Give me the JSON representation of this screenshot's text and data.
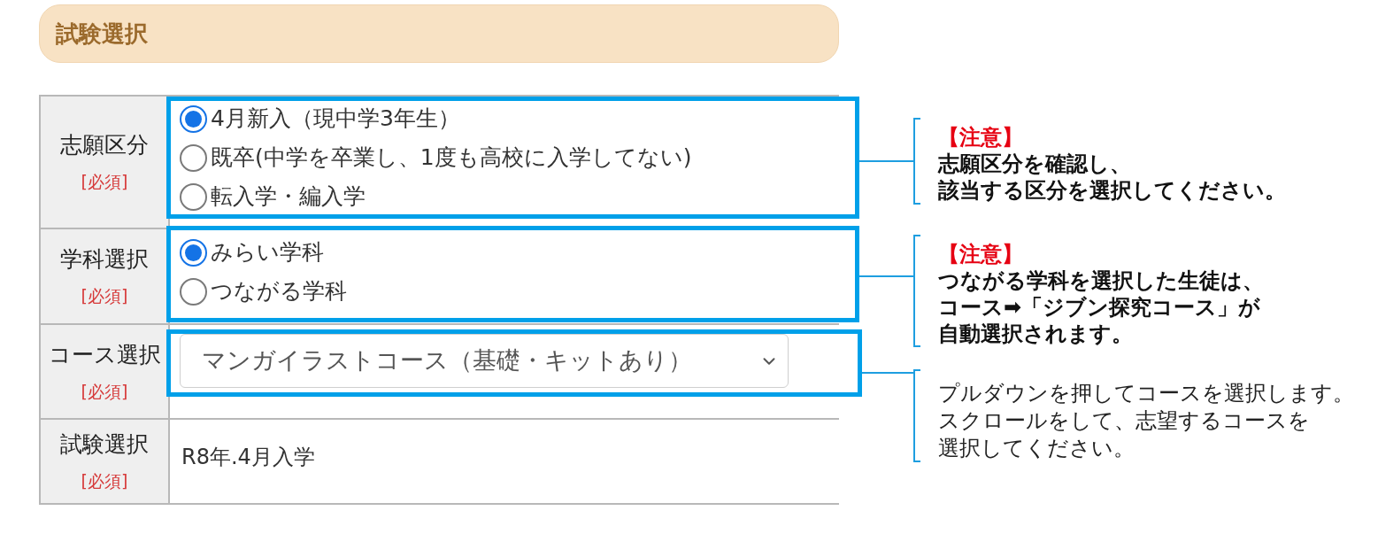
{
  "section": {
    "title": "試験選択"
  },
  "form": {
    "rows": [
      {
        "label": "志願区分",
        "required": "[必須]",
        "highlighted": true,
        "kind": "radio",
        "options": [
          {
            "label": "4月新入（現中学3年生）",
            "selected": true
          },
          {
            "label": "既卒(中学を卒業し、1度も高校に入学してない)",
            "selected": false
          },
          {
            "label": "転入学・編入学",
            "selected": false
          }
        ]
      },
      {
        "label": "学科選択",
        "required": "[必須]",
        "highlighted": true,
        "kind": "radio",
        "options": [
          {
            "label": "みらい学科",
            "selected": true
          },
          {
            "label": "つながる学科",
            "selected": false
          }
        ]
      },
      {
        "label": "コース選択",
        "required": "[必須]",
        "highlighted": true,
        "kind": "select",
        "value": "マンガイラストコース（基礎・キットあり）"
      },
      {
        "label": "試験選択",
        "required": "[必須]",
        "highlighted": false,
        "kind": "text",
        "value": "R8年.4月入学"
      }
    ]
  },
  "callouts": [
    {
      "kind": "warning",
      "heading": "【注意】",
      "lines": [
        "志願区分を確認し、",
        "該当する区分を選択してください。"
      ]
    },
    {
      "kind": "warning",
      "heading": "【注意】",
      "lines": [
        "つながる学科を選択した生徒は、",
        "コース➡「ジブン探究コース」が",
        "自動選択されます。"
      ]
    },
    {
      "kind": "info",
      "lines": [
        "プルダウンを押してコースを選択します。",
        "スクロールをして、志望するコースを",
        "選択してください。"
      ]
    }
  ]
}
